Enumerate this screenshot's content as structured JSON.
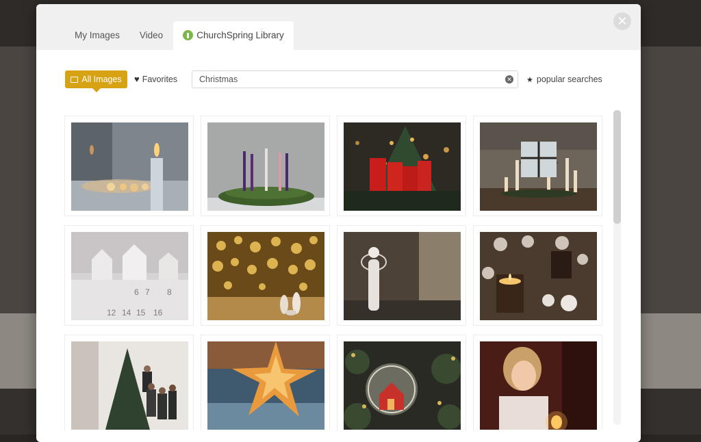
{
  "tabs": [
    {
      "label": "My Images",
      "active": false
    },
    {
      "label": "Video",
      "active": false
    },
    {
      "label": "ChurchSpring Library",
      "active": true
    }
  ],
  "filters": {
    "all_images_label": "All Images",
    "favorites_label": "Favorites"
  },
  "search": {
    "value": "Christmas",
    "placeholder": ""
  },
  "popular_searches_label": "popular searches",
  "colors": {
    "accent": "#d7a214",
    "leaf": "#7ab648"
  },
  "images": [
    {
      "subject": "single-candle-window"
    },
    {
      "subject": "advent-wreath-purple-candles"
    },
    {
      "subject": "red-candles-christmas-tree"
    },
    {
      "subject": "candles-in-stone-room"
    },
    {
      "subject": "advent-calendar-houses"
    },
    {
      "subject": "nativity-figures-bokeh"
    },
    {
      "subject": "angel-figurine"
    },
    {
      "subject": "candle-cookies-table"
    },
    {
      "subject": "family-decorating-tree"
    },
    {
      "subject": "paper-star-lantern"
    },
    {
      "subject": "glass-ornament-house"
    },
    {
      "subject": "girl-holding-candle"
    }
  ]
}
